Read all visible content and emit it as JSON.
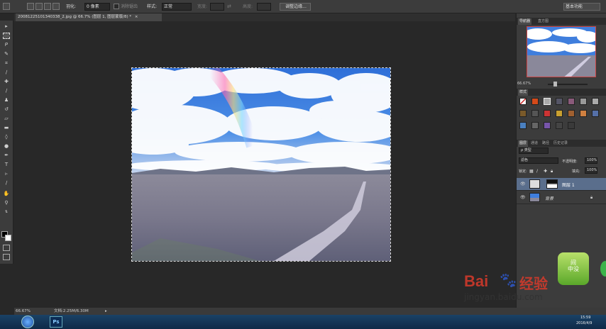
{
  "options_bar": {
    "feather_label": "羽化:",
    "feather_value": "0 像素",
    "antialias_label": "消除锯齿",
    "style_label": "样式:",
    "style_value": "正常",
    "width_label": "宽度:",
    "height_label": "高度:",
    "refine_edge_label": "调整边缘...",
    "workspace_label": "基本功能"
  },
  "document_tab": {
    "title": "20081225101340338_2.jpg @ 66.7% (图层 1, 图层蒙版/8) *",
    "close_glyph": "×"
  },
  "navigator": {
    "tabs": [
      "导航器",
      "直方图"
    ],
    "zoom": "66.67%"
  },
  "swatches_panel": {
    "tab": "样式"
  },
  "layers_panel": {
    "tabs": [
      "图层",
      "通道",
      "路径",
      "历史记录"
    ],
    "kind_label": "ρ 类型",
    "blend_mode": "滤色",
    "opacity_label": "不透明度:",
    "opacity_value": "100%",
    "lock_label": "锁定:",
    "fill_label": "填充:",
    "fill_value": "100%",
    "layers": [
      {
        "name": "图层 1"
      },
      {
        "name": "背景"
      }
    ]
  },
  "status_bar": {
    "zoom": "66.67%",
    "doc_info": "文档:2.25M/6.30M"
  },
  "taskbar": {
    "time": "15:59",
    "date": "2016/4/9"
  },
  "watermark": {
    "brand": "Bai",
    "brand2": "经验",
    "url": "jingyan.baidu.com",
    "badge": "间\n中没"
  },
  "colors": {
    "ui_bg": "#3c3c3c",
    "canvas_bg": "#282828",
    "selection_red": "#cc4444",
    "baidu_red": "#d93a2b",
    "baidu_blue": "#2f57c7"
  }
}
